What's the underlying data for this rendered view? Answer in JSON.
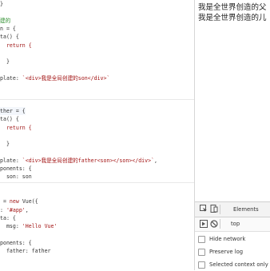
{
  "editor": {
    "lines": [
      [
        {
          "t": "}",
          "c": "plain"
        }
      ],
      [
        {
          "t": "",
          "c": "plain"
        }
      ],
      [
        {
          "t": "建的",
          "c": "cmt"
        }
      ],
      [
        {
          "t": "n = {",
          "c": "plain"
        }
      ],
      [
        {
          "t": "ta() {",
          "c": "plain"
        }
      ],
      [
        {
          "t": "  return {",
          "c": "kw"
        }
      ],
      [
        {
          "t": "",
          "c": "plain"
        }
      ],
      [
        {
          "t": "  }",
          "c": "plain"
        }
      ],
      [
        {
          "t": "",
          "c": "plain"
        }
      ],
      [
        {
          "t": "plate: ",
          "c": "plain"
        },
        {
          "t": "`<div>我是全局创建的son</div>`",
          "c": "str"
        }
      ],
      [
        {
          "t": "",
          "c": "plain"
        }
      ],
      [
        {
          "t": "",
          "c": "plain"
        }
      ],
      [
        {
          "t": "",
          "c": "plain"
        }
      ],
      [
        {
          "t": "ther = {",
          "c": "plain"
        }
      ],
      [
        {
          "t": "ta() {",
          "c": "plain"
        }
      ],
      [
        {
          "t": "  return {",
          "c": "kw"
        }
      ],
      [
        {
          "t": "",
          "c": "plain"
        }
      ],
      [
        {
          "t": "  }",
          "c": "plain"
        }
      ],
      [
        {
          "t": "",
          "c": "plain"
        }
      ],
      [
        {
          "t": "plate: ",
          "c": "plain"
        },
        {
          "t": "`<div>我是全局创建的father<son></son></div>`",
          "c": "str"
        },
        {
          "t": ",",
          "c": "plain"
        }
      ],
      [
        {
          "t": "ponents: {",
          "c": "plain"
        }
      ],
      [
        {
          "t": "  son: son",
          "c": "plain"
        }
      ],
      [
        {
          "t": "",
          "c": "plain"
        }
      ],
      [
        {
          "t": "",
          "c": "plain"
        }
      ],
      [
        {
          "t": " = ",
          "c": "plain"
        },
        {
          "t": "new",
          "c": "kw"
        },
        {
          "t": " Vue({",
          "c": "plain"
        }
      ],
      [
        {
          "t": ": ",
          "c": "plain"
        },
        {
          "t": "'#app'",
          "c": "str"
        },
        {
          "t": ",",
          "c": "plain"
        }
      ],
      [
        {
          "t": "ta: {",
          "c": "plain"
        }
      ],
      [
        {
          "t": "  msg: ",
          "c": "plain"
        },
        {
          "t": "'Hello Vue'",
          "c": "str"
        }
      ],
      [
        {
          "t": "",
          "c": "plain"
        }
      ],
      [
        {
          "t": "ponents: {",
          "c": "plain"
        }
      ],
      [
        {
          "t": "  father: father",
          "c": "plain"
        }
      ]
    ]
  },
  "page": {
    "lines": [
      "我是全世界创造的父",
      "我是全世界创造的儿"
    ]
  },
  "devtools": {
    "tab_elements": "Elements",
    "context_label": "top",
    "options": [
      {
        "label": "Hide network",
        "checked": false
      },
      {
        "label": "Preserve log",
        "checked": false
      },
      {
        "label": "Selected context only",
        "checked": false
      }
    ],
    "icons": [
      "inspect-icon",
      "device-toggle-icon",
      "execute-icon",
      "clear-console-icon"
    ]
  }
}
